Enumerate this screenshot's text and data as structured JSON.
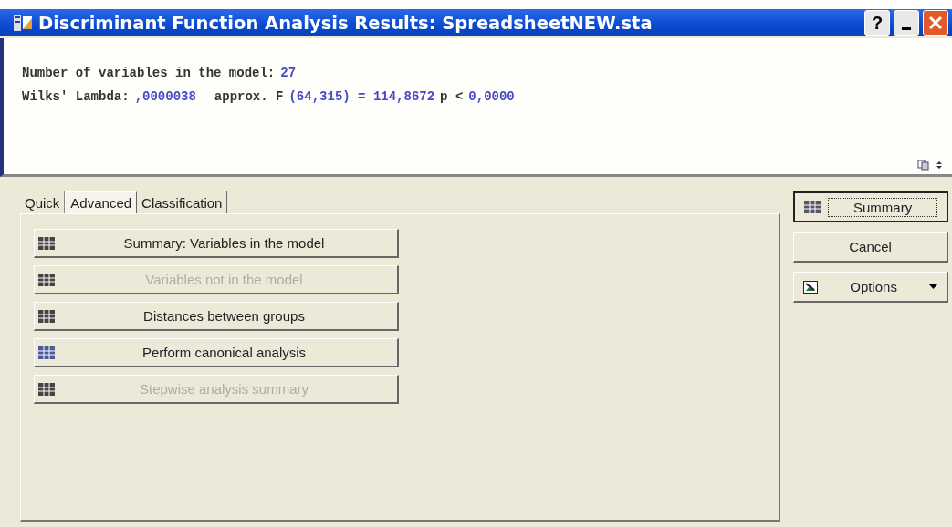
{
  "window": {
    "title": "Discriminant Function Analysis Results: SpreadsheetNEW.sta",
    "controls": [
      {
        "kind": "help",
        "label": "?"
      },
      {
        "kind": "minimize"
      },
      {
        "kind": "close"
      }
    ]
  },
  "results": [
    {
      "label": "Number of variables in the model:",
      "value": "27"
    },
    {
      "label": "Wilks' Lambda:",
      "value": ",0000038",
      "label2": "approx. F",
      "value2": "(64,315) = 114,8672",
      "label3": "p <",
      "value3": "0,0000"
    }
  ],
  "tabs": [
    {
      "label": "Quick",
      "selected": false
    },
    {
      "label": "Advanced",
      "selected": true
    },
    {
      "label": "Classification",
      "selected": false
    }
  ],
  "actions": [
    {
      "label": "Summary: Variables in the model",
      "disabled": false
    },
    {
      "label": "Variables not in the model",
      "disabled": true
    },
    {
      "label": "Distances between groups",
      "disabled": false
    },
    {
      "label": "Perform canonical analysis",
      "disabled": false
    },
    {
      "label": "Stepwise analysis summary",
      "disabled": true
    }
  ],
  "side_buttons": [
    {
      "kind": "summary",
      "label": "Summary",
      "focused": true
    },
    {
      "kind": "cancel",
      "label": "Cancel",
      "focused": false
    },
    {
      "kind": "options",
      "label": "Options",
      "focused": false
    }
  ]
}
